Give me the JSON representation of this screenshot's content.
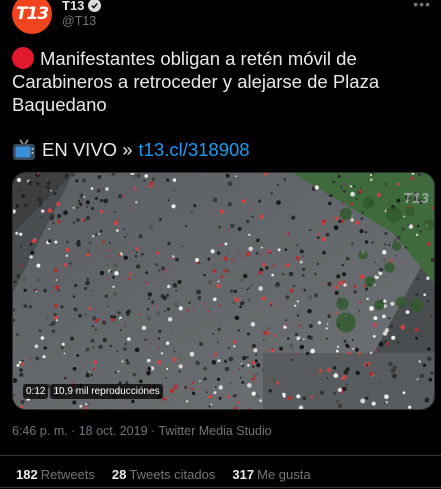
{
  "account": {
    "avatar_text": "T13",
    "name": "T13",
    "handle": "@T13"
  },
  "tweet": {
    "text": "Manifestantes obligan a retén móvil de Carabineros a retroceder y alejarse de Plaza Baquedano",
    "live_label": "EN VIVO »",
    "link": "t13.cl/318908"
  },
  "media": {
    "watermark": "T13",
    "duration": "0:12",
    "views": "10,9 mil reproducciones"
  },
  "meta": {
    "time": "6:46 p. m.",
    "date": "18 oct. 2019",
    "source": "Twitter Media Studio"
  },
  "stats": {
    "retweets_count": "182",
    "retweets_label": "Retweets",
    "quotes_count": "28",
    "quotes_label": "Tweets citados",
    "likes_count": "317",
    "likes_label": "Me gusta"
  },
  "colors": {
    "brand": "#f0441e",
    "link": "#1d9bf0",
    "background": "#000000"
  }
}
